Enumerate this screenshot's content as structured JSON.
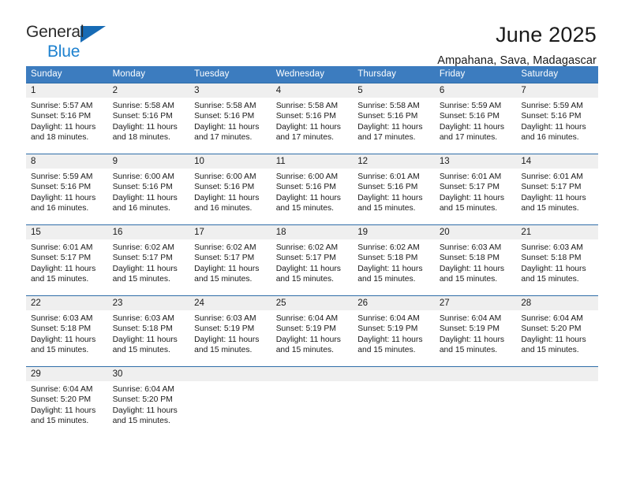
{
  "logo": {
    "line1": "General",
    "line2": "Blue",
    "triangle_color": "#176bb5",
    "blue_text_color": "#1d81cf"
  },
  "header": {
    "title": "June 2025",
    "subtitle": "Ampahana, Sava, Madagascar"
  },
  "theme": {
    "header_blue": "#3c7cbf",
    "rule_blue": "#2f6da8",
    "daynum_band": "#efefef"
  },
  "labels": {
    "sunrise_prefix": "Sunrise:",
    "sunset_prefix": "Sunset:",
    "daylight_prefix": "Daylight:"
  },
  "weekdays": [
    "Sunday",
    "Monday",
    "Tuesday",
    "Wednesday",
    "Thursday",
    "Friday",
    "Saturday"
  ],
  "weeks": [
    [
      {
        "day": "1",
        "sunrise": "Sunrise: 5:57 AM",
        "sunset": "Sunset: 5:16 PM",
        "daylight_1": "Daylight: 11 hours",
        "daylight_2": "and 18 minutes."
      },
      {
        "day": "2",
        "sunrise": "Sunrise: 5:58 AM",
        "sunset": "Sunset: 5:16 PM",
        "daylight_1": "Daylight: 11 hours",
        "daylight_2": "and 18 minutes."
      },
      {
        "day": "3",
        "sunrise": "Sunrise: 5:58 AM",
        "sunset": "Sunset: 5:16 PM",
        "daylight_1": "Daylight: 11 hours",
        "daylight_2": "and 17 minutes."
      },
      {
        "day": "4",
        "sunrise": "Sunrise: 5:58 AM",
        "sunset": "Sunset: 5:16 PM",
        "daylight_1": "Daylight: 11 hours",
        "daylight_2": "and 17 minutes."
      },
      {
        "day": "5",
        "sunrise": "Sunrise: 5:58 AM",
        "sunset": "Sunset: 5:16 PM",
        "daylight_1": "Daylight: 11 hours",
        "daylight_2": "and 17 minutes."
      },
      {
        "day": "6",
        "sunrise": "Sunrise: 5:59 AM",
        "sunset": "Sunset: 5:16 PM",
        "daylight_1": "Daylight: 11 hours",
        "daylight_2": "and 17 minutes."
      },
      {
        "day": "7",
        "sunrise": "Sunrise: 5:59 AM",
        "sunset": "Sunset: 5:16 PM",
        "daylight_1": "Daylight: 11 hours",
        "daylight_2": "and 16 minutes."
      }
    ],
    [
      {
        "day": "8",
        "sunrise": "Sunrise: 5:59 AM",
        "sunset": "Sunset: 5:16 PM",
        "daylight_1": "Daylight: 11 hours",
        "daylight_2": "and 16 minutes."
      },
      {
        "day": "9",
        "sunrise": "Sunrise: 6:00 AM",
        "sunset": "Sunset: 5:16 PM",
        "daylight_1": "Daylight: 11 hours",
        "daylight_2": "and 16 minutes."
      },
      {
        "day": "10",
        "sunrise": "Sunrise: 6:00 AM",
        "sunset": "Sunset: 5:16 PM",
        "daylight_1": "Daylight: 11 hours",
        "daylight_2": "and 16 minutes."
      },
      {
        "day": "11",
        "sunrise": "Sunrise: 6:00 AM",
        "sunset": "Sunset: 5:16 PM",
        "daylight_1": "Daylight: 11 hours",
        "daylight_2": "and 15 minutes."
      },
      {
        "day": "12",
        "sunrise": "Sunrise: 6:01 AM",
        "sunset": "Sunset: 5:16 PM",
        "daylight_1": "Daylight: 11 hours",
        "daylight_2": "and 15 minutes."
      },
      {
        "day": "13",
        "sunrise": "Sunrise: 6:01 AM",
        "sunset": "Sunset: 5:17 PM",
        "daylight_1": "Daylight: 11 hours",
        "daylight_2": "and 15 minutes."
      },
      {
        "day": "14",
        "sunrise": "Sunrise: 6:01 AM",
        "sunset": "Sunset: 5:17 PM",
        "daylight_1": "Daylight: 11 hours",
        "daylight_2": "and 15 minutes."
      }
    ],
    [
      {
        "day": "15",
        "sunrise": "Sunrise: 6:01 AM",
        "sunset": "Sunset: 5:17 PM",
        "daylight_1": "Daylight: 11 hours",
        "daylight_2": "and 15 minutes."
      },
      {
        "day": "16",
        "sunrise": "Sunrise: 6:02 AM",
        "sunset": "Sunset: 5:17 PM",
        "daylight_1": "Daylight: 11 hours",
        "daylight_2": "and 15 minutes."
      },
      {
        "day": "17",
        "sunrise": "Sunrise: 6:02 AM",
        "sunset": "Sunset: 5:17 PM",
        "daylight_1": "Daylight: 11 hours",
        "daylight_2": "and 15 minutes."
      },
      {
        "day": "18",
        "sunrise": "Sunrise: 6:02 AM",
        "sunset": "Sunset: 5:17 PM",
        "daylight_1": "Daylight: 11 hours",
        "daylight_2": "and 15 minutes."
      },
      {
        "day": "19",
        "sunrise": "Sunrise: 6:02 AM",
        "sunset": "Sunset: 5:18 PM",
        "daylight_1": "Daylight: 11 hours",
        "daylight_2": "and 15 minutes."
      },
      {
        "day": "20",
        "sunrise": "Sunrise: 6:03 AM",
        "sunset": "Sunset: 5:18 PM",
        "daylight_1": "Daylight: 11 hours",
        "daylight_2": "and 15 minutes."
      },
      {
        "day": "21",
        "sunrise": "Sunrise: 6:03 AM",
        "sunset": "Sunset: 5:18 PM",
        "daylight_1": "Daylight: 11 hours",
        "daylight_2": "and 15 minutes."
      }
    ],
    [
      {
        "day": "22",
        "sunrise": "Sunrise: 6:03 AM",
        "sunset": "Sunset: 5:18 PM",
        "daylight_1": "Daylight: 11 hours",
        "daylight_2": "and 15 minutes."
      },
      {
        "day": "23",
        "sunrise": "Sunrise: 6:03 AM",
        "sunset": "Sunset: 5:18 PM",
        "daylight_1": "Daylight: 11 hours",
        "daylight_2": "and 15 minutes."
      },
      {
        "day": "24",
        "sunrise": "Sunrise: 6:03 AM",
        "sunset": "Sunset: 5:19 PM",
        "daylight_1": "Daylight: 11 hours",
        "daylight_2": "and 15 minutes."
      },
      {
        "day": "25",
        "sunrise": "Sunrise: 6:04 AM",
        "sunset": "Sunset: 5:19 PM",
        "daylight_1": "Daylight: 11 hours",
        "daylight_2": "and 15 minutes."
      },
      {
        "day": "26",
        "sunrise": "Sunrise: 6:04 AM",
        "sunset": "Sunset: 5:19 PM",
        "daylight_1": "Daylight: 11 hours",
        "daylight_2": "and 15 minutes."
      },
      {
        "day": "27",
        "sunrise": "Sunrise: 6:04 AM",
        "sunset": "Sunset: 5:19 PM",
        "daylight_1": "Daylight: 11 hours",
        "daylight_2": "and 15 minutes."
      },
      {
        "day": "28",
        "sunrise": "Sunrise: 6:04 AM",
        "sunset": "Sunset: 5:20 PM",
        "daylight_1": "Daylight: 11 hours",
        "daylight_2": "and 15 minutes."
      }
    ],
    [
      {
        "day": "29",
        "sunrise": "Sunrise: 6:04 AM",
        "sunset": "Sunset: 5:20 PM",
        "daylight_1": "Daylight: 11 hours",
        "daylight_2": "and 15 minutes."
      },
      {
        "day": "30",
        "sunrise": "Sunrise: 6:04 AM",
        "sunset": "Sunset: 5:20 PM",
        "daylight_1": "Daylight: 11 hours",
        "daylight_2": "and 15 minutes."
      },
      {
        "day": "",
        "sunrise": "",
        "sunset": "",
        "daylight_1": "",
        "daylight_2": ""
      },
      {
        "day": "",
        "sunrise": "",
        "sunset": "",
        "daylight_1": "",
        "daylight_2": ""
      },
      {
        "day": "",
        "sunrise": "",
        "sunset": "",
        "daylight_1": "",
        "daylight_2": ""
      },
      {
        "day": "",
        "sunrise": "",
        "sunset": "",
        "daylight_1": "",
        "daylight_2": ""
      },
      {
        "day": "",
        "sunrise": "",
        "sunset": "",
        "daylight_1": "",
        "daylight_2": ""
      }
    ]
  ]
}
